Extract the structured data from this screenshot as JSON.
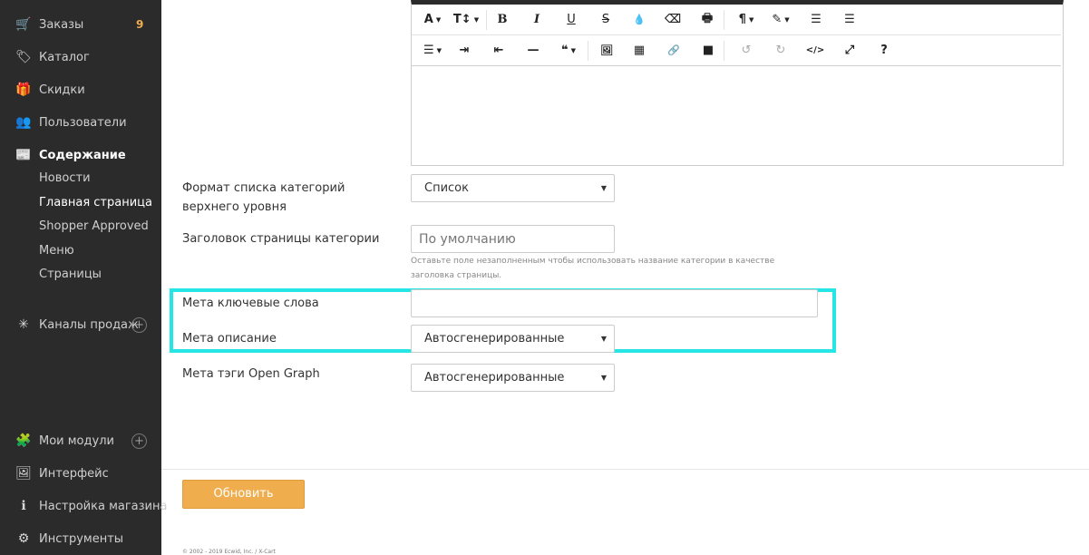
{
  "sidebar": {
    "items": [
      {
        "icon": "orders-icon",
        "glyph": "🛒",
        "label": "Заказы",
        "badge": "9"
      },
      {
        "icon": "tag-icon",
        "glyph": "🏷",
        "label": "Каталог"
      },
      {
        "icon": "gift-icon",
        "glyph": "🎁",
        "label": "Скидки"
      },
      {
        "icon": "users-icon",
        "glyph": "👥",
        "label": "Пользователи"
      },
      {
        "icon": "content-icon",
        "glyph": "📰",
        "label": "Содержание"
      },
      {
        "icon": "channels-icon",
        "glyph": "✳",
        "label": "Каналы продаж"
      },
      {
        "icon": "modules-icon",
        "glyph": "🧩",
        "label": "Мои модули"
      },
      {
        "icon": "interface-icon",
        "glyph": "🖼",
        "label": "Интерфейс"
      },
      {
        "icon": "info-icon",
        "glyph": "ℹ",
        "label": "Настройка магазина"
      },
      {
        "icon": "gear-icon",
        "glyph": "⚙",
        "label": "Инструменты"
      }
    ],
    "content_subitems": [
      "Новости",
      "Главная страница",
      "Shopper Approved",
      "Меню",
      "Страницы"
    ],
    "plus": "+"
  },
  "editor": {
    "row1": [
      {
        "name": "font-style-button",
        "text": "A",
        "caret": "▼"
      },
      {
        "name": "font-size-button",
        "text": "T↕",
        "caret": "▼"
      },
      {
        "name": "bold-button",
        "text": "B"
      },
      {
        "name": "italic-button",
        "text": "I"
      },
      {
        "name": "underline-button",
        "text": "U"
      },
      {
        "name": "strikethrough-button",
        "text": "S"
      },
      {
        "name": "color-button",
        "text": "💧"
      },
      {
        "name": "eraser-button",
        "text": "⌫"
      },
      {
        "name": "print-button",
        "text": "🖶"
      },
      {
        "name": "paragraph-button",
        "text": "¶",
        "caret": "▼"
      },
      {
        "name": "magic-button",
        "text": "✎",
        "caret": "▼"
      },
      {
        "name": "ordered-list-button",
        "text": "☰"
      },
      {
        "name": "unordered-list-button",
        "text": "☰"
      }
    ],
    "row2": [
      {
        "name": "align-button",
        "text": "☰",
        "caret": "▼"
      },
      {
        "name": "indent-button",
        "text": "⇥"
      },
      {
        "name": "outdent-button",
        "text": "⇤"
      },
      {
        "name": "hr-button",
        "text": "—"
      },
      {
        "name": "quote-button",
        "text": "❝",
        "caret": "▼"
      },
      {
        "name": "image-button",
        "text": "🖼"
      },
      {
        "name": "table-button",
        "text": "▦"
      },
      {
        "name": "link-button",
        "text": "🔗"
      },
      {
        "name": "video-button",
        "text": "■"
      },
      {
        "name": "undo-button",
        "text": "↺"
      },
      {
        "name": "redo-button",
        "text": "↻"
      },
      {
        "name": "code-button",
        "text": "</>"
      },
      {
        "name": "fullscreen-button",
        "text": "⤢"
      },
      {
        "name": "help-button",
        "text": "?"
      }
    ]
  },
  "form": {
    "category_format_label": "Формат списка категорий верхнего уровня",
    "category_format_value": "Список",
    "category_title_label": "Заголовок страницы категории",
    "category_title_placeholder": "По умолчанию",
    "category_title_hint": "Оставьте поле незаполненным чтобы использовать название категории в качестве заголовка страницы.",
    "meta_keywords_label": "Мета ключевые слова",
    "meta_keywords_value": "",
    "meta_description_label": "Мета описание",
    "meta_description_value": "Автосгенерированные",
    "og_tags_label": "Мета тэги Open Graph",
    "og_tags_value": "Автосгенерированные",
    "select_arrow": "▼"
  },
  "actions": {
    "update_label": "Обновить"
  },
  "footer": {
    "copyright": "© 2002 - 2019 Ecwid, Inc. / X-Cart"
  },
  "colors": {
    "sidebar_bg": "#2b2b2b",
    "accent": "#f0ad4e",
    "highlight": "#25e5e5"
  }
}
